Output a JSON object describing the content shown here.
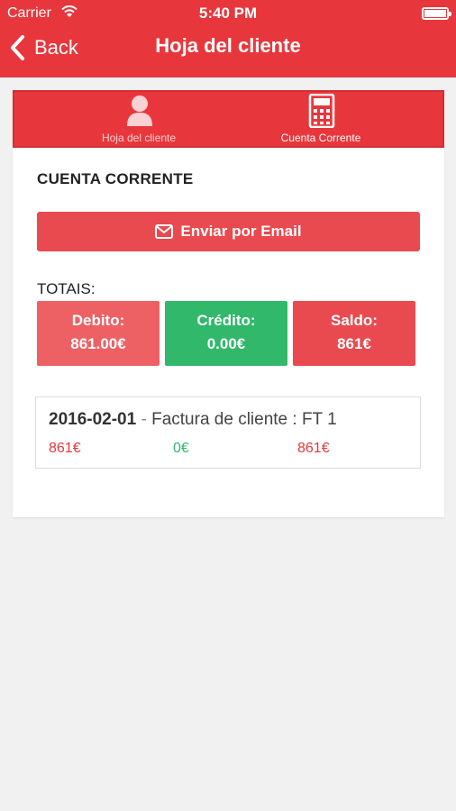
{
  "status_bar": {
    "carrier": "Carrier",
    "time": "5:40 PM"
  },
  "nav": {
    "back_label": "Back",
    "title": "Hoja del cliente"
  },
  "tabs": [
    {
      "label": "Hoja del cliente",
      "icon": "person-icon"
    },
    {
      "label": "Cuenta Corrente",
      "icon": "calculator-icon"
    }
  ],
  "section_title": "CUENTA CORRENTE",
  "email_button": {
    "label": "Enviar por Email",
    "icon": "envelope-icon"
  },
  "totals": {
    "label": "TOTAIS:",
    "items": [
      {
        "label": "Debito:",
        "value": "861.00€",
        "color": "#ed6165"
      },
      {
        "label": "Crédito:",
        "value": "0.00€",
        "color": "#31b86b"
      },
      {
        "label": "Saldo:",
        "value": "861€",
        "color": "#e84a4f"
      }
    ]
  },
  "entries": [
    {
      "date": "2016-02-01",
      "separator": " - ",
      "description": "Factura de cliente : FT 1",
      "debit": "861€",
      "credit": "0€",
      "balance": "861€"
    }
  ],
  "colors": {
    "accent": "#e8373c",
    "positive": "#31b86b",
    "background": "#f1f1f1"
  }
}
